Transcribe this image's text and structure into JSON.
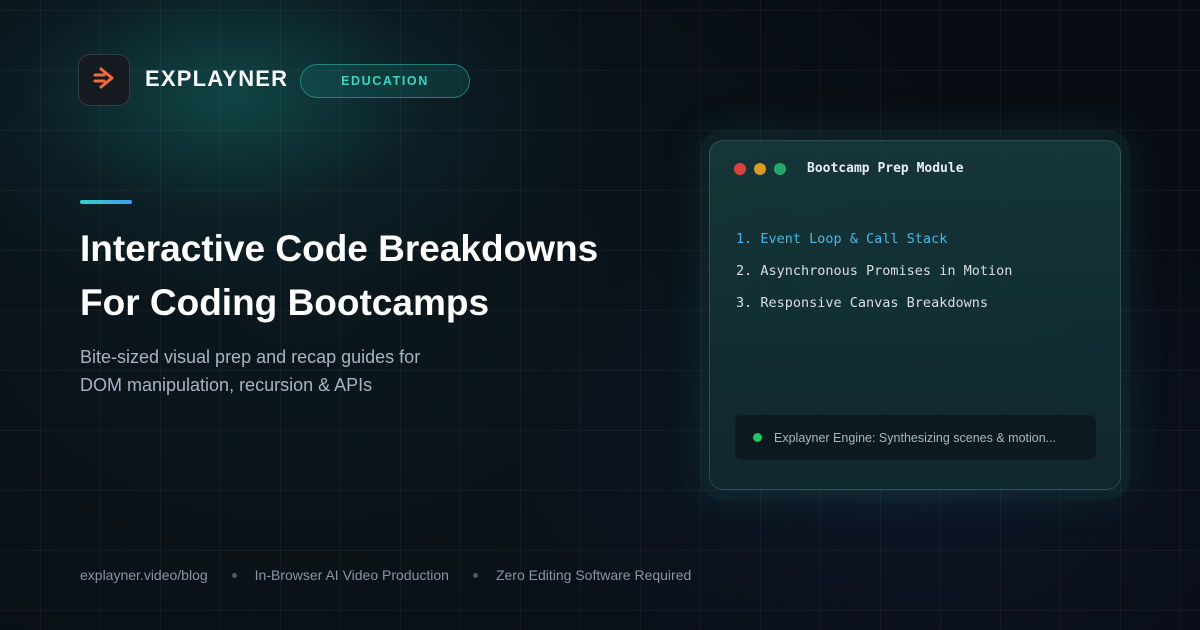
{
  "brand": {
    "name": "EXPLAYNER",
    "badge": "EDUCATION",
    "logo_icon": "play-arrow-lines-icon",
    "accent_color": "#f26a3c"
  },
  "hero": {
    "headline_line1": "Interactive Code Breakdowns",
    "headline_line2": "For Coding Bootcamps",
    "subtext_line1": "Bite-sized visual prep and recap guides for",
    "subtext_line2": "DOM manipulation, recursion & APIs"
  },
  "code_window": {
    "title": "Bootcamp Prep Module",
    "modules": [
      "1. Event Loop & Call Stack",
      "2. Asynchronous Promises in Motion",
      "3. Responsive Canvas Breakdowns"
    ],
    "active_module_color": "#49b8e8",
    "status_text": "Explayner Engine: Synthesizing scenes & motion...",
    "status_color": "#22c55e"
  },
  "footer": {
    "url": "explayner.video/blog",
    "feature1": "In-Browser AI Video Production",
    "feature2": "Zero Editing Software Required"
  }
}
